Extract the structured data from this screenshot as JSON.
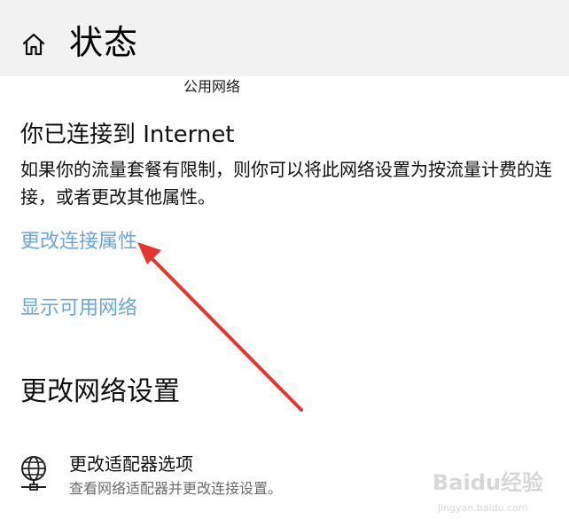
{
  "header": {
    "title": "状态",
    "home_icon": "home-icon"
  },
  "network": {
    "type_label": "公用网络"
  },
  "status": {
    "heading": "你已连接到 Internet",
    "description": "如果你的流量套餐有限制，则你可以将此网络设置为按流量计费的连接，或者更改其他属性。"
  },
  "links": {
    "change_connection_properties": "更改连接属性",
    "show_available_networks": "显示可用网络"
  },
  "section": {
    "heading": "更改网络设置"
  },
  "adapter_option": {
    "icon": "network-adapter-icon",
    "title": "更改适配器选项",
    "description": "查看网络适配器并更改连接设置。"
  },
  "annotation": {
    "color": "#e8332f",
    "type": "arrow"
  },
  "watermark": {
    "brand": "Baidu经验",
    "domain": "jingyan.baidu.com"
  },
  "colors": {
    "link": "#6aa6df",
    "header_bg": "#f2f2f2",
    "secondary_text": "#6b6b6b"
  }
}
